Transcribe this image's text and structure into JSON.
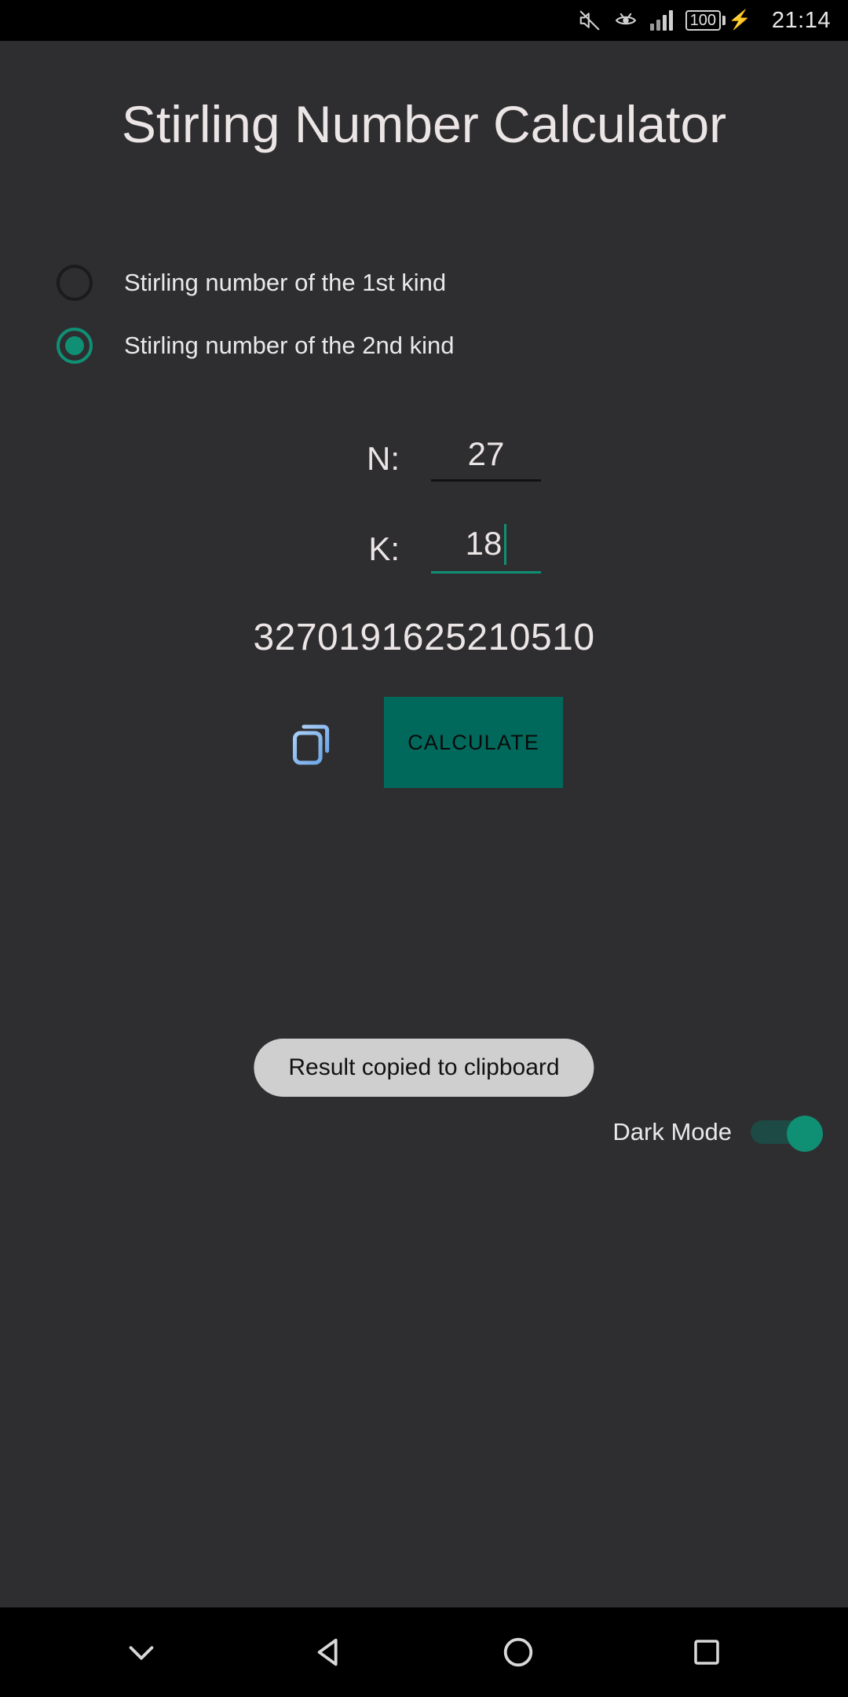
{
  "statusbar": {
    "icons": [
      "mute-icon",
      "eye-comfort-icon",
      "signal-bars-icon",
      "battery-icon",
      "charging-bolt-icon"
    ],
    "battery_level": "100",
    "time": "21:14"
  },
  "app": {
    "title": "Stirling Number Calculator",
    "radio_options": [
      {
        "label": "Stirling number of the 1st kind",
        "selected": false
      },
      {
        "label": "Stirling number of the 2nd kind",
        "selected": true
      }
    ],
    "fields": [
      {
        "label": "N:",
        "value": "27",
        "focused": false
      },
      {
        "label": "K:",
        "value": "18",
        "focused": true
      }
    ],
    "result": "3270191625210510",
    "copy_icon": "copy-icon",
    "calculate_label": "CALCULATE",
    "toast": "Result copied to clipboard",
    "dark_mode": {
      "label": "Dark Mode",
      "enabled": true
    }
  },
  "navbar": {
    "items": [
      "hide-keyboard-chevron-icon",
      "back-icon",
      "home-icon",
      "recents-icon"
    ]
  },
  "colors": {
    "background": "#2e2e30",
    "accent_teal": "#0f8f73",
    "button_teal": "#00695c",
    "copy_icon_blue": "#8ab8f0",
    "text_primary": "#ece5e5",
    "toast_bg": "#cfcfcf"
  }
}
